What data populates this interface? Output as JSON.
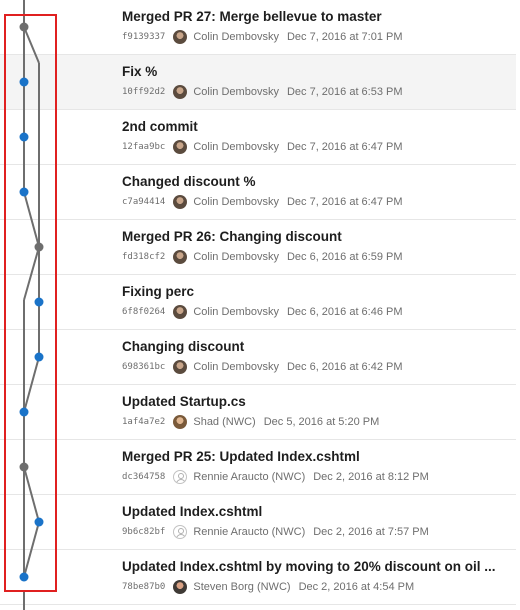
{
  "commits": [
    {
      "title": "Merged PR 27: Merge bellevue to master",
      "hash": "f9139337",
      "author": "Colin Dembovsky",
      "date": "Dec 7, 2016 at 7:01 PM",
      "avatar": "photo-colin",
      "lane": "left",
      "merge": true
    },
    {
      "title": "Fix %",
      "hash": "10ff92d2",
      "author": "Colin Dembovsky",
      "date": "Dec 7, 2016 at 6:53 PM",
      "avatar": "photo-colin",
      "lane": "left",
      "merge": false
    },
    {
      "title": "2nd commit",
      "hash": "12faa9bc",
      "author": "Colin Dembovsky",
      "date": "Dec 7, 2016 at 6:47 PM",
      "avatar": "photo-colin",
      "lane": "left",
      "merge": false
    },
    {
      "title": "Changed discount %",
      "hash": "c7a94414",
      "author": "Colin Dembovsky",
      "date": "Dec 7, 2016 at 6:47 PM",
      "avatar": "photo-colin",
      "lane": "left",
      "merge": false
    },
    {
      "title": "Merged PR 26: Changing discount",
      "hash": "fd318cf2",
      "author": "Colin Dembovsky",
      "date": "Dec 6, 2016 at 6:59 PM",
      "avatar": "photo-colin",
      "lane": "right",
      "merge": true
    },
    {
      "title": "Fixing perc",
      "hash": "6f8f0264",
      "author": "Colin Dembovsky",
      "date": "Dec 6, 2016 at 6:46 PM",
      "avatar": "photo-colin",
      "lane": "right",
      "merge": false
    },
    {
      "title": "Changing discount",
      "hash": "698361bc",
      "author": "Colin Dembovsky",
      "date": "Dec 6, 2016 at 6:42 PM",
      "avatar": "photo-colin",
      "lane": "right",
      "merge": false
    },
    {
      "title": "Updated Startup.cs",
      "hash": "1af4a7e2",
      "author": "Shad (NWC)",
      "date": "Dec 5, 2016 at 5:20 PM",
      "avatar": "photo-shad",
      "lane": "left",
      "merge": false
    },
    {
      "title": "Merged PR 25: Updated Index.cshtml",
      "hash": "dc364758",
      "author": "Rennie Araucto (NWC)",
      "date": "Dec 2, 2016 at 8:12 PM",
      "avatar": "placeholder",
      "lane": "left",
      "merge": true
    },
    {
      "title": "Updated Index.cshtml",
      "hash": "9b6c82bf",
      "author": "Rennie Araucto (NWC)",
      "date": "Dec 2, 2016 at 7:57 PM",
      "avatar": "placeholder",
      "lane": "right",
      "merge": false
    },
    {
      "title": "Updated Index.cshtml by moving to 20% discount on oil ...",
      "hash": "78be87b0",
      "author": "Steven Borg (NWC)",
      "date": "Dec 2, 2016 at 4:54 PM",
      "avatar": "photo-steven",
      "lane": "left",
      "merge": false
    }
  ],
  "colors": {
    "line": "#6e6e6e",
    "commit_dot": "#1a73c8",
    "merge_dot": "#6e6e6e",
    "selection": "#e02020",
    "hover_row": "#f4f4f4"
  }
}
